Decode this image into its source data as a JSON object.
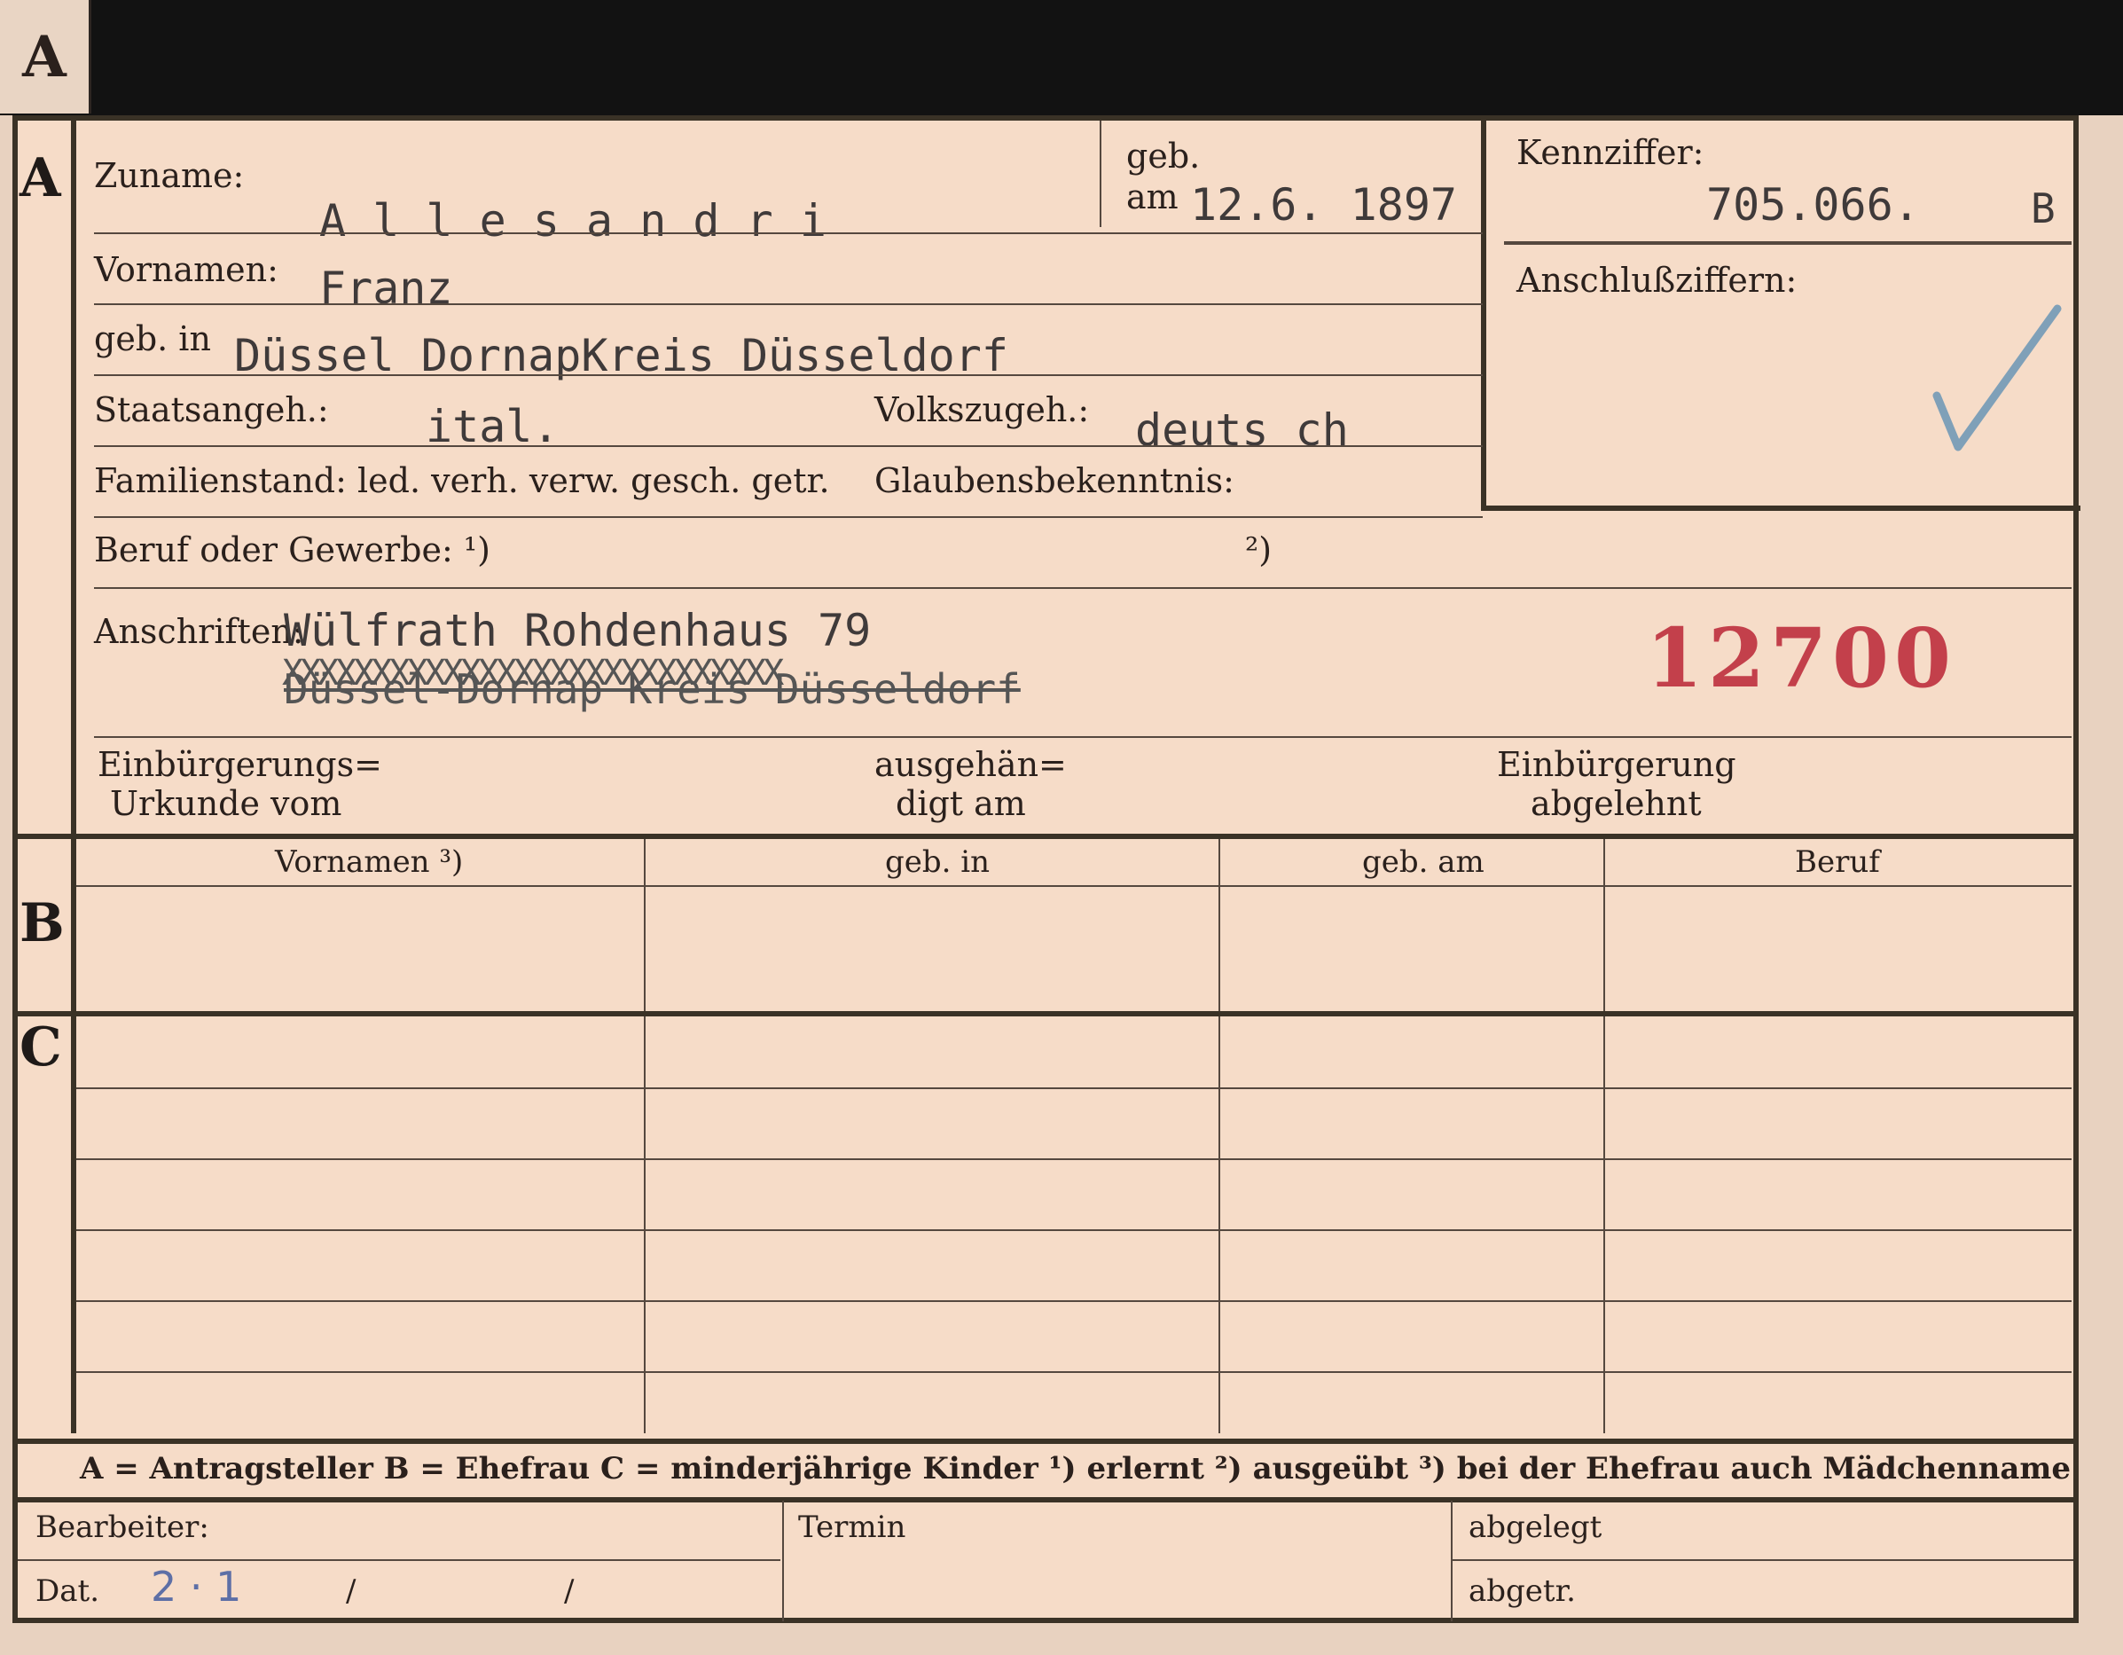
{
  "tab_letter": "A",
  "sections": {
    "a": "A",
    "b": "B",
    "c": "C"
  },
  "labels": {
    "zuname": "Zuname:",
    "geb": "geb.",
    "am": "am",
    "kennziffer": "Kennziffer:",
    "anschlussziffern": "Anschlußziffern:",
    "vornamen": "Vornamen:",
    "geb_in": "geb. in",
    "staatsangeh": "Staatsangeh.:",
    "volkszugeh": "Volkszugeh.:",
    "familienstand": "Familienstand: led. verh. verw. gesch. getr.",
    "glaubensbekenntnis": "Glaubensbekenntnis:",
    "beruf": "Beruf oder Gewerbe: ¹)",
    "beruf_note2": "²)",
    "anschriften": "Anschriften:",
    "einbuergerungs_1": "Einbürgerungs=",
    "einbuergerungs_2": "Urkunde vom",
    "ausgehaen_1": "ausgehän=",
    "ausgehaen_2": "digt am",
    "einbuergerung_1": "Einbürgerung",
    "einbuergerung_2": "abgelehnt"
  },
  "values": {
    "zuname": "A l l e s a n d r i",
    "geb_am": "12.6. 1897",
    "kennziffer": "705.066.",
    "kennziffer_suffix": "B",
    "vornamen": "Franz",
    "geb_in": "Düssel DornapKreis Düsseldorf",
    "staatsangeh": "ital.",
    "volkszugeh": "deuts ch",
    "anschrift_1": "Wülfrath Rohdenhaus  79",
    "anschrift_2_struck": "Düssel-Dornap Kreis Düsseldorf",
    "anschrift_2_xs": "XXXXXXXXXXXXXXXXXXXXXXXXXXXX",
    "stamp": "12700"
  },
  "table": {
    "headers": [
      "Vornamen ³)",
      "geb. in",
      "geb. am",
      "Beruf"
    ]
  },
  "legend": "A = Antragsteller   B = Ehefrau   C = minderjährige Kinder   ¹) erlernt   ²) ausgeübt   ³) bei der Ehefrau auch Mädchenname",
  "footer": {
    "bearbeiter": "Bearbeiter:",
    "dat": "Dat.",
    "dat_value": "2 · 1",
    "slash1": "/",
    "slash2": "/",
    "termin": "Termin",
    "abgelegt": "abgelegt",
    "abgetr": "abgetr."
  },
  "colors": {
    "stamp": "#c3404b",
    "check": "#7fa0b8",
    "ink": "#5d6fa6"
  }
}
